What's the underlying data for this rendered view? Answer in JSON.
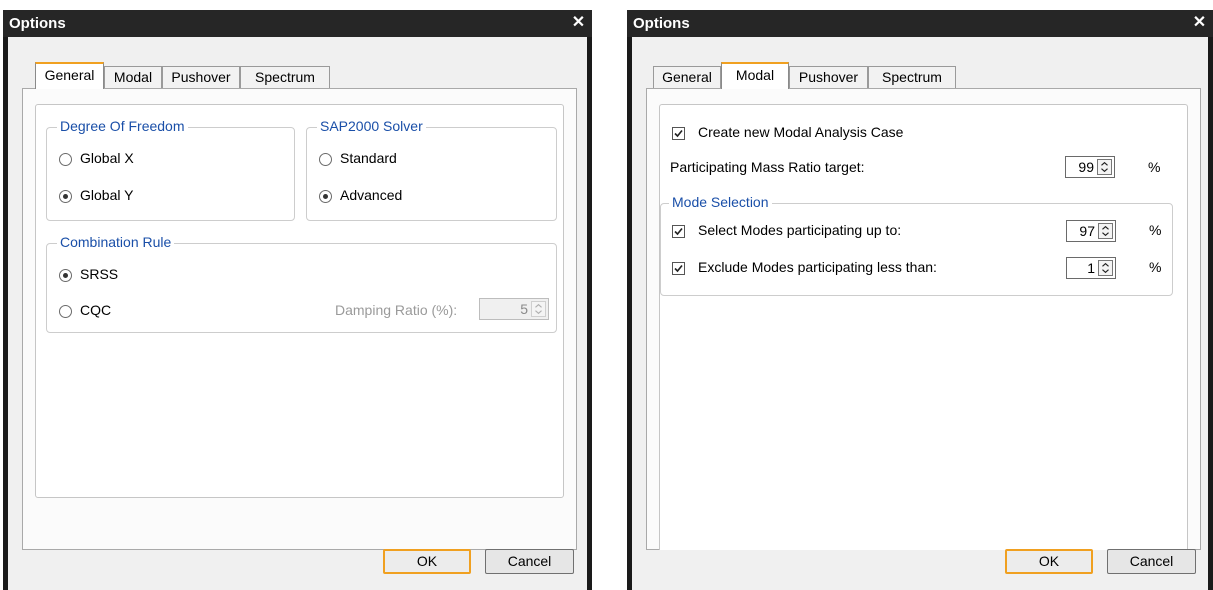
{
  "dialog1": {
    "title": "Options",
    "tabs": [
      "General",
      "Modal",
      "Pushover",
      "Spectrum"
    ],
    "dof": {
      "title": "Degree Of Freedom",
      "options": [
        "Global X",
        "Global Y"
      ],
      "selected": "Global Y"
    },
    "solver": {
      "title": "SAP2000 Solver",
      "options": [
        "Standard",
        "Advanced"
      ],
      "selected": "Advanced"
    },
    "combination": {
      "title": "Combination Rule",
      "options": [
        "SRSS",
        "CQC"
      ],
      "selected": "SRSS",
      "damping_label": "Damping Ratio (%):",
      "damping_value": "5"
    },
    "ok": "OK",
    "cancel": "Cancel"
  },
  "dialog2": {
    "title": "Options",
    "tabs": [
      "General",
      "Modal",
      "Pushover",
      "Spectrum"
    ],
    "create_modal": {
      "label": "Create new Modal Analysis Case",
      "checked": true
    },
    "mass_ratio": {
      "label": "Participating Mass Ratio target:",
      "value": "99",
      "unit": "%"
    },
    "mode_selection": {
      "title": "Mode Selection",
      "select_up_to": {
        "label": "Select Modes participating up to:",
        "value": "97",
        "unit": "%",
        "checked": true
      },
      "exclude_less": {
        "label": "Exclude Modes participating less than:",
        "value": "1",
        "unit": "%",
        "checked": true
      }
    },
    "ok": "OK",
    "cancel": "Cancel"
  },
  "icons": {
    "close": "close-icon",
    "radio": "radio-button-icon",
    "check": "checkmark-icon",
    "spin": "spin-arrows-icon"
  },
  "colors": {
    "title_bar": "#262626",
    "legend_text": "#1a4fa8",
    "active_tab_accent": "#f0a020"
  }
}
